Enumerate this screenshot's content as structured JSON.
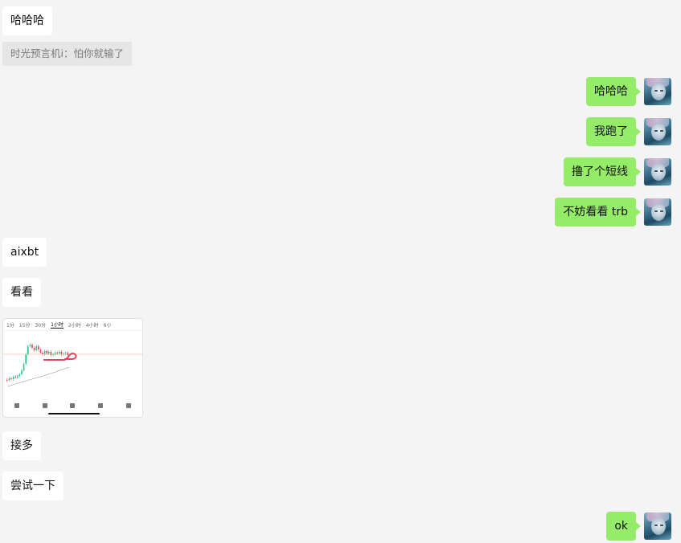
{
  "messages": [
    {
      "id": "m1",
      "side": "in",
      "text": "哈哈哈"
    },
    {
      "id": "m2",
      "side": "quote",
      "text": "时光预言机i：怕你就输了"
    },
    {
      "id": "m3",
      "side": "out",
      "text": "哈哈哈"
    },
    {
      "id": "m4",
      "side": "out",
      "text": "我跑了"
    },
    {
      "id": "m5",
      "side": "out",
      "text": "撸了个短线"
    },
    {
      "id": "m6",
      "side": "out",
      "text": "不妨看看 trb"
    },
    {
      "id": "m7",
      "side": "in",
      "text": "aixbt"
    },
    {
      "id": "m8",
      "side": "in",
      "text": "看看"
    },
    {
      "id": "m9",
      "side": "in-image"
    },
    {
      "id": "m10",
      "side": "in",
      "text": "接多"
    },
    {
      "id": "m11",
      "side": "in",
      "text": "尝试一下"
    },
    {
      "id": "m12",
      "side": "out",
      "text": "ok"
    }
  ],
  "image_message": {
    "timeframes": [
      "1分",
      "15分",
      "30分",
      "1小时",
      "2小时",
      "4小时",
      "6小"
    ],
    "active_timeframe": "1小时",
    "colors": {
      "up": "#2fbf8f",
      "down": "#e0475a",
      "annotation": "#e0475a"
    }
  },
  "colors": {
    "background": "#f4f4f4",
    "incoming_bubble": "#ffffff",
    "outgoing_bubble": "#95ec69",
    "quote_background": "#e6e6e6",
    "quote_text": "#7a7a7a"
  }
}
